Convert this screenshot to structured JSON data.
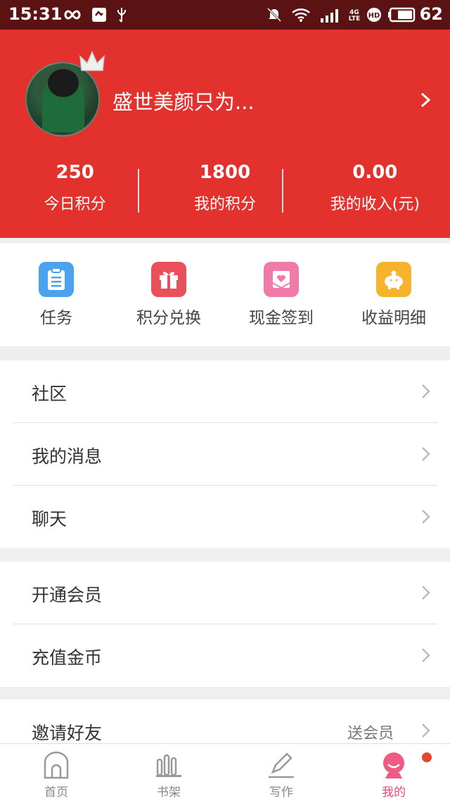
{
  "status_bar": {
    "time": "15:31",
    "network": "4G LTE",
    "battery": "62",
    "icons": [
      "infinity-icon",
      "app-notification-icon",
      "usb-icon",
      "mute-icon",
      "wifi-icon",
      "signal-icon",
      "hd-icon",
      "battery-icon"
    ]
  },
  "profile": {
    "username": "盛世美颜只为...",
    "avatar_icon": "avatar",
    "crown_icon": "crown-icon",
    "accent_color": "#e3312d"
  },
  "stats": [
    {
      "value": "250",
      "label": "今日积分"
    },
    {
      "value": "1800",
      "label": "我的积分"
    },
    {
      "value": "0.00",
      "label": "我的收入(元)"
    }
  ],
  "quick_actions": [
    {
      "label": "任务",
      "icon": "task-list-icon",
      "color": "#4aa3ec"
    },
    {
      "label": "积分兑换",
      "icon": "gift-icon",
      "color": "#e9505b"
    },
    {
      "label": "现金签到",
      "icon": "heart-envelope-icon",
      "color": "#f07aa8"
    },
    {
      "label": "收益明细",
      "icon": "piggy-bank-icon",
      "color": "#f6b32c"
    }
  ],
  "menu_group_1": [
    {
      "label": "社区"
    },
    {
      "label": "我的消息"
    },
    {
      "label": "聊天"
    }
  ],
  "menu_group_2": [
    {
      "label": "开通会员"
    },
    {
      "label": "充值金币"
    }
  ],
  "menu_group_3": [
    {
      "label": "邀请好友",
      "extra": "送会员"
    }
  ],
  "bottom_nav": [
    {
      "label": "首页",
      "icon": "home-icon"
    },
    {
      "label": "书架",
      "icon": "bookshelf-icon"
    },
    {
      "label": "写作",
      "icon": "pen-icon"
    },
    {
      "label": "我的",
      "icon": "profile-icon",
      "active": true
    }
  ]
}
